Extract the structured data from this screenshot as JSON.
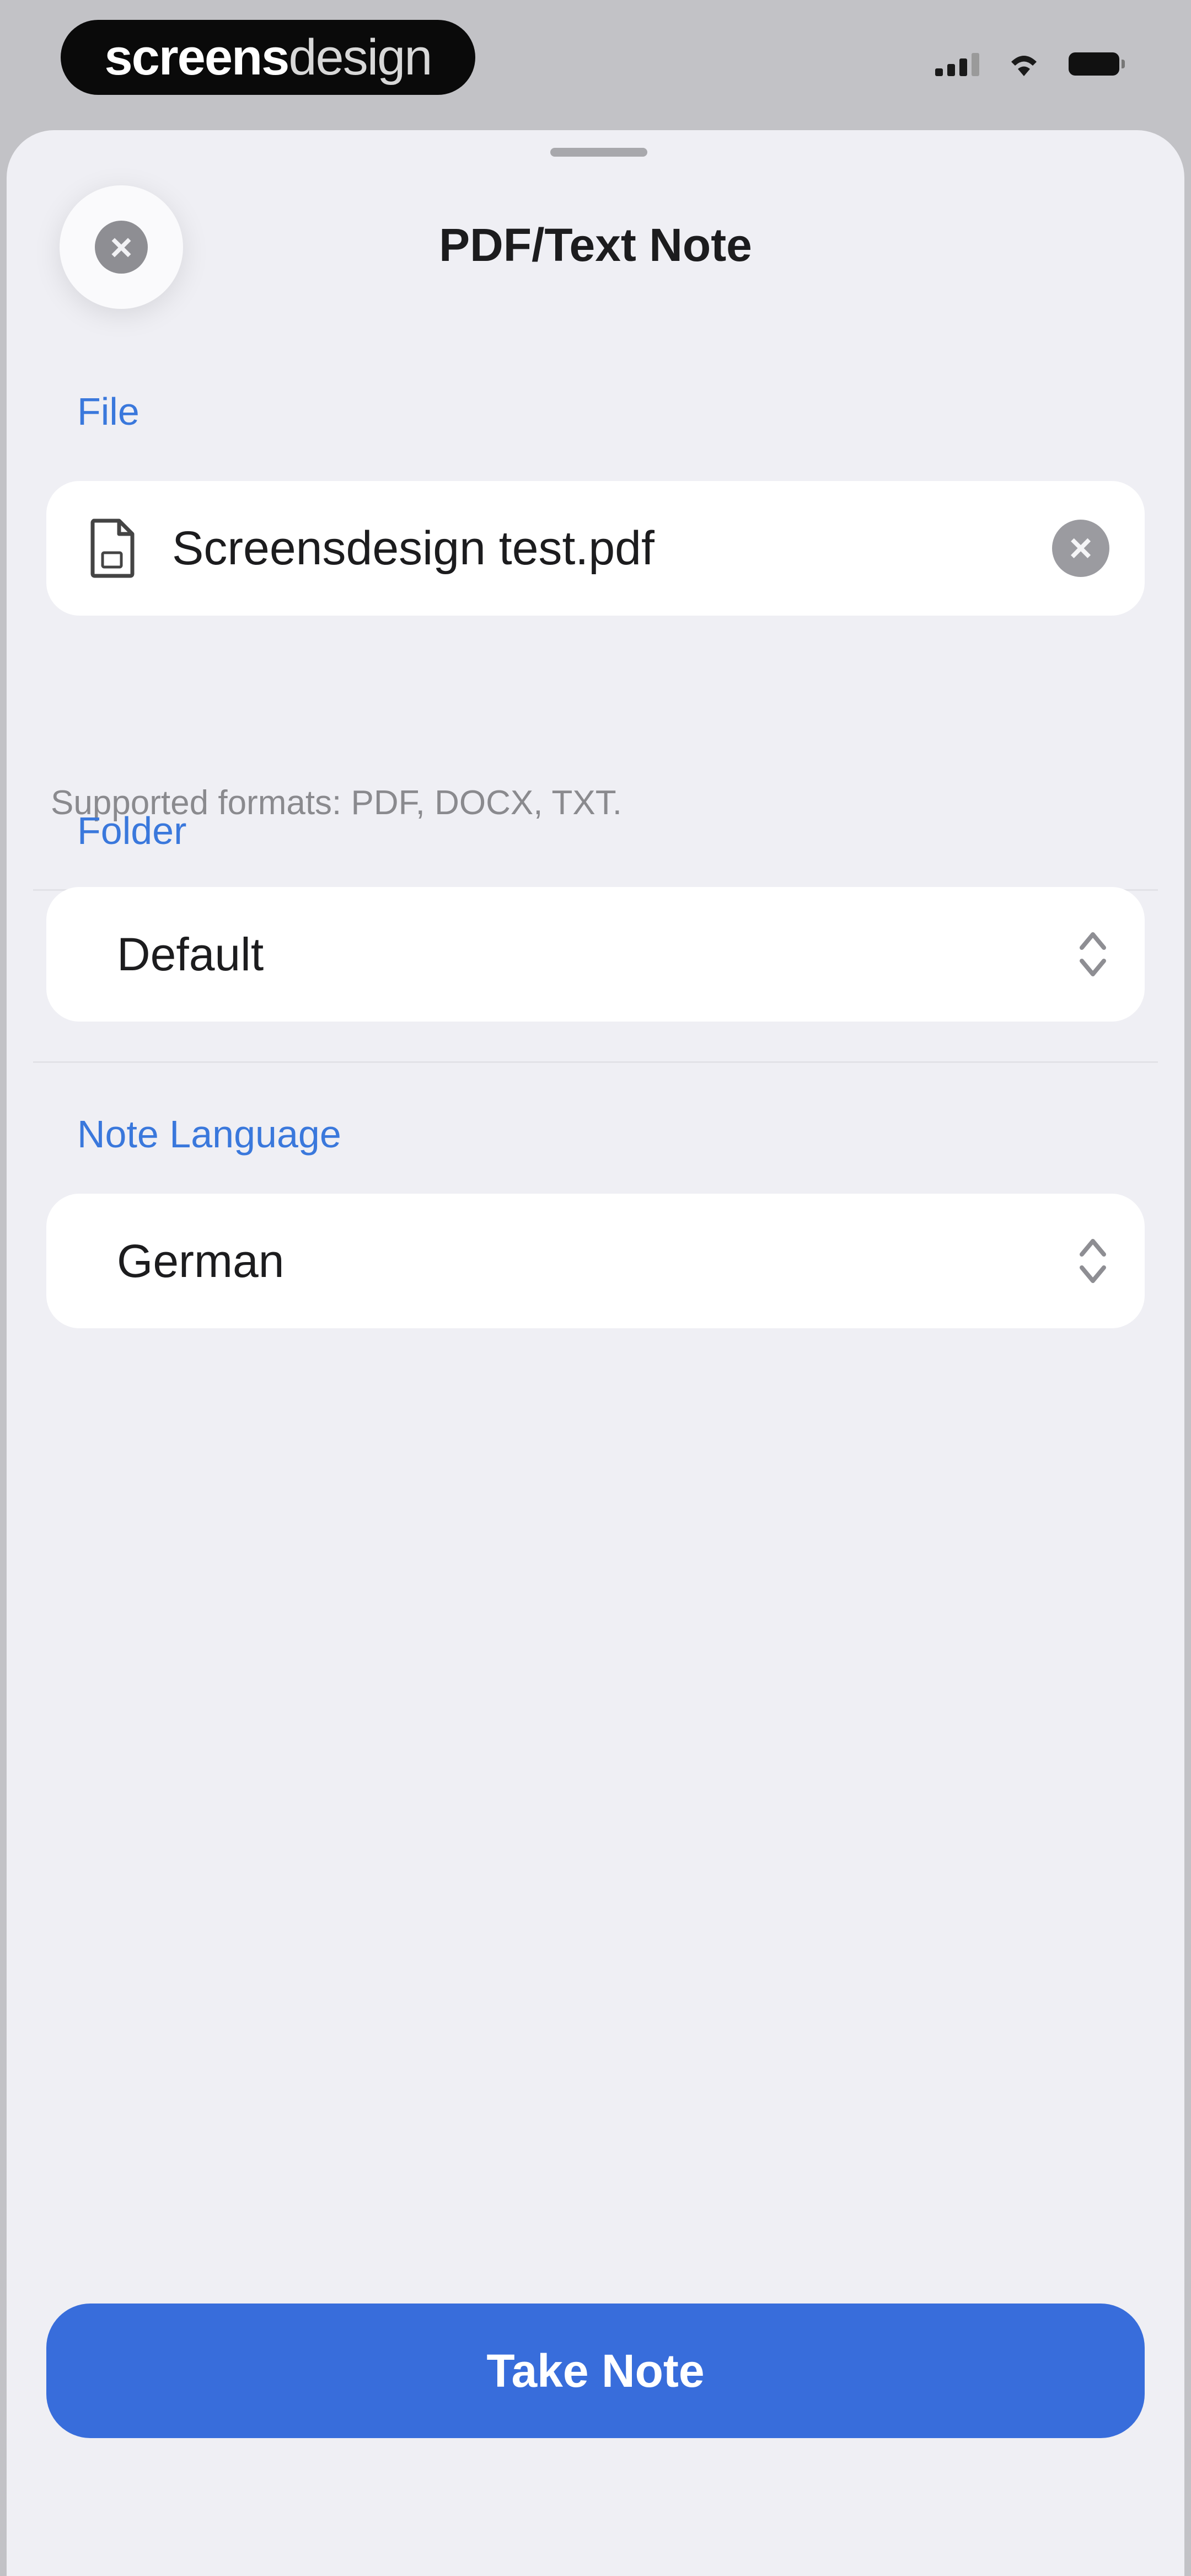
{
  "status_bar": {
    "brand_bold": "screens",
    "brand_light": "design",
    "icons": [
      "cellular-signal-icon",
      "wifi-icon",
      "battery-icon"
    ]
  },
  "sheet": {
    "title": "PDF/Text Note",
    "close_icon": "close-icon"
  },
  "file_section": {
    "label": "File",
    "file_name": "Screensdesign test.pdf",
    "file_icon": "document-icon",
    "clear_icon": "clear-icon",
    "hint": "Supported formats: PDF, DOCX, TXT."
  },
  "folder_section": {
    "label": "Folder",
    "value": "Default",
    "icon": "chevron-up-down-icon"
  },
  "language_section": {
    "label": "Note Language",
    "value": "German",
    "icon": "chevron-up-down-icon"
  },
  "actions": {
    "primary_label": "Take Note"
  },
  "colors": {
    "accent": "#386ddb",
    "label": "#3a78dc",
    "background": "#efeff4",
    "card": "#ffffff"
  }
}
